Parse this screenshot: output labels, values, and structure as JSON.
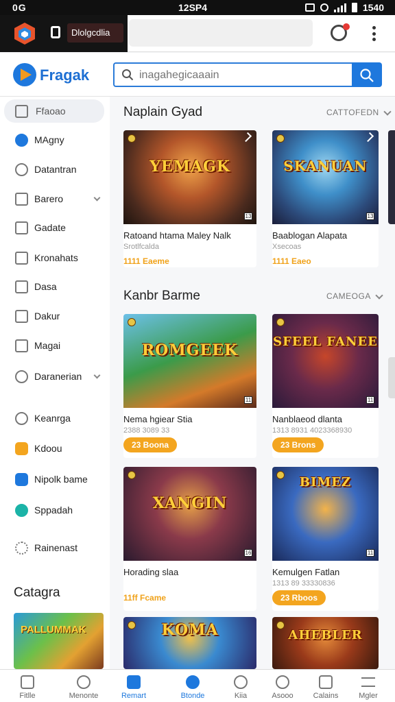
{
  "status_bar": {
    "left": "0G",
    "time": "12SP4",
    "clock": "1540"
  },
  "browser": {
    "tab_title": "Dlolgcdlia"
  },
  "site": {
    "brand": "Fragak",
    "search_placeholder": "inagahegicaaain",
    "colors": {
      "accent": "#1e78dd",
      "price": "#f0a21a",
      "badge": "#f3a51f"
    }
  },
  "sidebar": {
    "items": [
      {
        "label": "Ffaoao",
        "icon": "calendar-icon",
        "active": true
      },
      {
        "label": "MAgny",
        "icon": "blue-circle-icon"
      },
      {
        "label": "Datantran",
        "icon": "globe-icon"
      },
      {
        "label": "Barero",
        "icon": "checkbox-icon",
        "chevron": true
      },
      {
        "label": "Gadate",
        "icon": "square-icon"
      },
      {
        "label": "Kronahats",
        "icon": "puzzle-icon"
      },
      {
        "label": "Dasa",
        "icon": "tag-icon"
      },
      {
        "label": "Dakur",
        "icon": "list-icon"
      },
      {
        "label": "Magai",
        "icon": "shield-icon"
      },
      {
        "label": "Daranerian",
        "icon": "target-icon",
        "chevron": true
      },
      {
        "label": "Keanrga",
        "icon": "settings-icon"
      },
      {
        "label": "Kdoou",
        "icon": "orange-check-icon"
      },
      {
        "label": "Nipolk bame",
        "icon": "blue-check-icon"
      },
      {
        "label": "Sppadah",
        "icon": "teal-circle-icon"
      },
      {
        "label": "Rainenast",
        "icon": "gear-icon"
      }
    ],
    "heading": "Catagra",
    "card_title": "PALLUMMAK"
  },
  "sections": [
    {
      "title": "Naplain Gyad",
      "category": "CATTOFEDN",
      "cards": [
        {
          "image_title": "YEMAGK",
          "name": "Ratoand htama Maley Nalk",
          "meta": "Srotlfcalda",
          "price": "1111 Eaeme",
          "rating": "13"
        },
        {
          "image_title": "SKANUAN",
          "name": "Baablogan Alapata",
          "meta": "Xsecoas",
          "price": "1111 Eaeo",
          "rating": "13"
        }
      ]
    },
    {
      "title": "Kanbr Barme",
      "category": "CAMEOGA",
      "cards": [
        {
          "image_title": "ROMGEEK",
          "name": "Nema hgiear Stia",
          "meta": "2388 3089 33",
          "pill": "23 Boona",
          "rating": "11"
        },
        {
          "image_title": "SFEEL FANEE",
          "name": "Nanblaeod dlanta",
          "meta": "1313 8931 4023368930",
          "pill": "23 Brons",
          "rating": "11"
        },
        {
          "image_title": "XANGIN",
          "name": "Horading slaa",
          "meta": "",
          "price": "11ff Fcame",
          "rating": "16"
        },
        {
          "image_title": "BIMEZ",
          "name": "Kemulgen Fatlan",
          "meta": "1313 89 33330836",
          "pill": "23 Rboos",
          "rating": "11"
        },
        {
          "image_title": "KOMA",
          "name": "",
          "meta": "",
          "price": ""
        },
        {
          "image_title": "AHEBLER",
          "name": "",
          "meta": "",
          "price": ""
        }
      ]
    }
  ],
  "bottom_nav": [
    {
      "label": "Fitlle",
      "icon": "home-icon"
    },
    {
      "label": "Menonte",
      "icon": "search-icon"
    },
    {
      "label": "Remart",
      "icon": "bookmark-icon",
      "active": true
    },
    {
      "label": "Btonde",
      "icon": "compass-icon",
      "active": true
    },
    {
      "label": "Kiia",
      "icon": "person-icon"
    },
    {
      "label": "Asooo",
      "icon": "chat-icon"
    },
    {
      "label": "Calains",
      "icon": "clipboard-icon"
    },
    {
      "label": "Mgler",
      "icon": "menu-icon"
    }
  ]
}
